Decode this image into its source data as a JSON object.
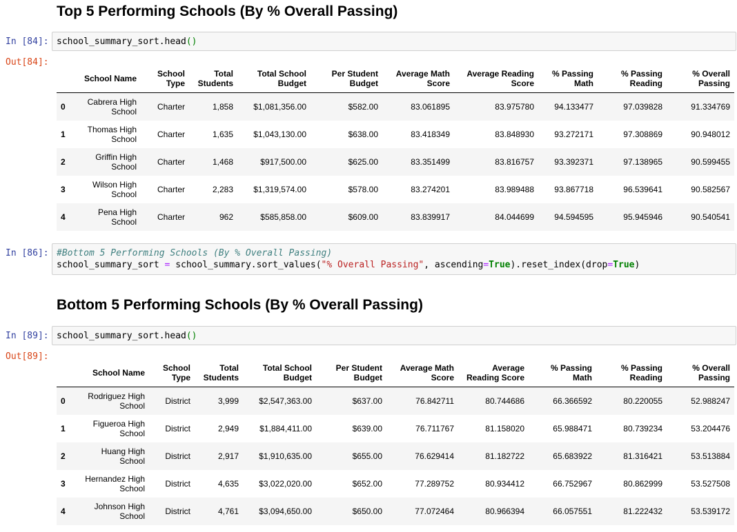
{
  "top_section": {
    "heading": "Top 5 Performing Schools (By % Overall Passing)",
    "in_prompt": "In [84]:",
    "out_prompt": "Out[84]:",
    "code": {
      "obj": "school_summary_sort.head",
      "parens": "()"
    },
    "columns": [
      "School Name",
      "School Type",
      "Total Students",
      "Total School Budget",
      "Per Student Budget",
      "Average Math Score",
      "Average Reading Score",
      "% Passing Math",
      "% Passing Reading",
      "% Overall Passing"
    ],
    "rows": [
      {
        "index": "0",
        "name": "Cabrera High School",
        "type": "Charter",
        "students": "1,858",
        "budget": "$1,081,356.00",
        "per_student": "$582.00",
        "math": "83.061895",
        "reading": "83.975780",
        "pass_math": "94.133477",
        "pass_reading": "97.039828",
        "overall": "91.334769"
      },
      {
        "index": "1",
        "name": "Thomas High School",
        "type": "Charter",
        "students": "1,635",
        "budget": "$1,043,130.00",
        "per_student": "$638.00",
        "math": "83.418349",
        "reading": "83.848930",
        "pass_math": "93.272171",
        "pass_reading": "97.308869",
        "overall": "90.948012"
      },
      {
        "index": "2",
        "name": "Griffin High School",
        "type": "Charter",
        "students": "1,468",
        "budget": "$917,500.00",
        "per_student": "$625.00",
        "math": "83.351499",
        "reading": "83.816757",
        "pass_math": "93.392371",
        "pass_reading": "97.138965",
        "overall": "90.599455"
      },
      {
        "index": "3",
        "name": "Wilson High School",
        "type": "Charter",
        "students": "2,283",
        "budget": "$1,319,574.00",
        "per_student": "$578.00",
        "math": "83.274201",
        "reading": "83.989488",
        "pass_math": "93.867718",
        "pass_reading": "96.539641",
        "overall": "90.582567"
      },
      {
        "index": "4",
        "name": "Pena High School",
        "type": "Charter",
        "students": "962",
        "budget": "$585,858.00",
        "per_student": "$609.00",
        "math": "83.839917",
        "reading": "84.044699",
        "pass_math": "94.594595",
        "pass_reading": "95.945946",
        "overall": "90.540541"
      }
    ]
  },
  "sort_cell": {
    "in_prompt": "In [86]:",
    "comment": "#Bottom 5 Performing Schools (By % Overall Passing)",
    "line2": {
      "lhs": "school_summary_sort ",
      "eq": "=",
      "call": " school_summary.sort_values(",
      "str": "\"% Overall Passing\"",
      "mid": ", ascending",
      "eq2": "=",
      "true1": "True",
      "reset": ").reset_index(drop",
      "eq3": "=",
      "true2": "True",
      "end": ")"
    }
  },
  "bottom_section": {
    "heading": "Bottom 5 Performing Schools (By % Overall Passing)",
    "in_prompt": "In [89]:",
    "out_prompt": "Out[89]:",
    "code": {
      "obj": "school_summary_sort.head",
      "parens": "()"
    },
    "columns": [
      "School Name",
      "School Type",
      "Total Students",
      "Total School Budget",
      "Per Student Budget",
      "Average Math Score",
      "Average Reading Score",
      "% Passing Math",
      "% Passing Reading",
      "% Overall Passing"
    ],
    "rows": [
      {
        "index": "0",
        "name": "Rodriguez High School",
        "type": "District",
        "students": "3,999",
        "budget": "$2,547,363.00",
        "per_student": "$637.00",
        "math": "76.842711",
        "reading": "80.744686",
        "pass_math": "66.366592",
        "pass_reading": "80.220055",
        "overall": "52.988247"
      },
      {
        "index": "1",
        "name": "Figueroa High School",
        "type": "District",
        "students": "2,949",
        "budget": "$1,884,411.00",
        "per_student": "$639.00",
        "math": "76.711767",
        "reading": "81.158020",
        "pass_math": "65.988471",
        "pass_reading": "80.739234",
        "overall": "53.204476"
      },
      {
        "index": "2",
        "name": "Huang High School",
        "type": "District",
        "students": "2,917",
        "budget": "$1,910,635.00",
        "per_student": "$655.00",
        "math": "76.629414",
        "reading": "81.182722",
        "pass_math": "65.683922",
        "pass_reading": "81.316421",
        "overall": "53.513884"
      },
      {
        "index": "3",
        "name": "Hernandez High School",
        "type": "District",
        "students": "4,635",
        "budget": "$3,022,020.00",
        "per_student": "$652.00",
        "math": "77.289752",
        "reading": "80.934412",
        "pass_math": "66.752967",
        "pass_reading": "80.862999",
        "overall": "53.527508"
      },
      {
        "index": "4",
        "name": "Johnson High School",
        "type": "District",
        "students": "4,761",
        "budget": "$3,094,650.00",
        "per_student": "$650.00",
        "math": "77.072464",
        "reading": "80.966394",
        "pass_math": "66.057551",
        "pass_reading": "81.222432",
        "overall": "53.539172"
      }
    ]
  }
}
